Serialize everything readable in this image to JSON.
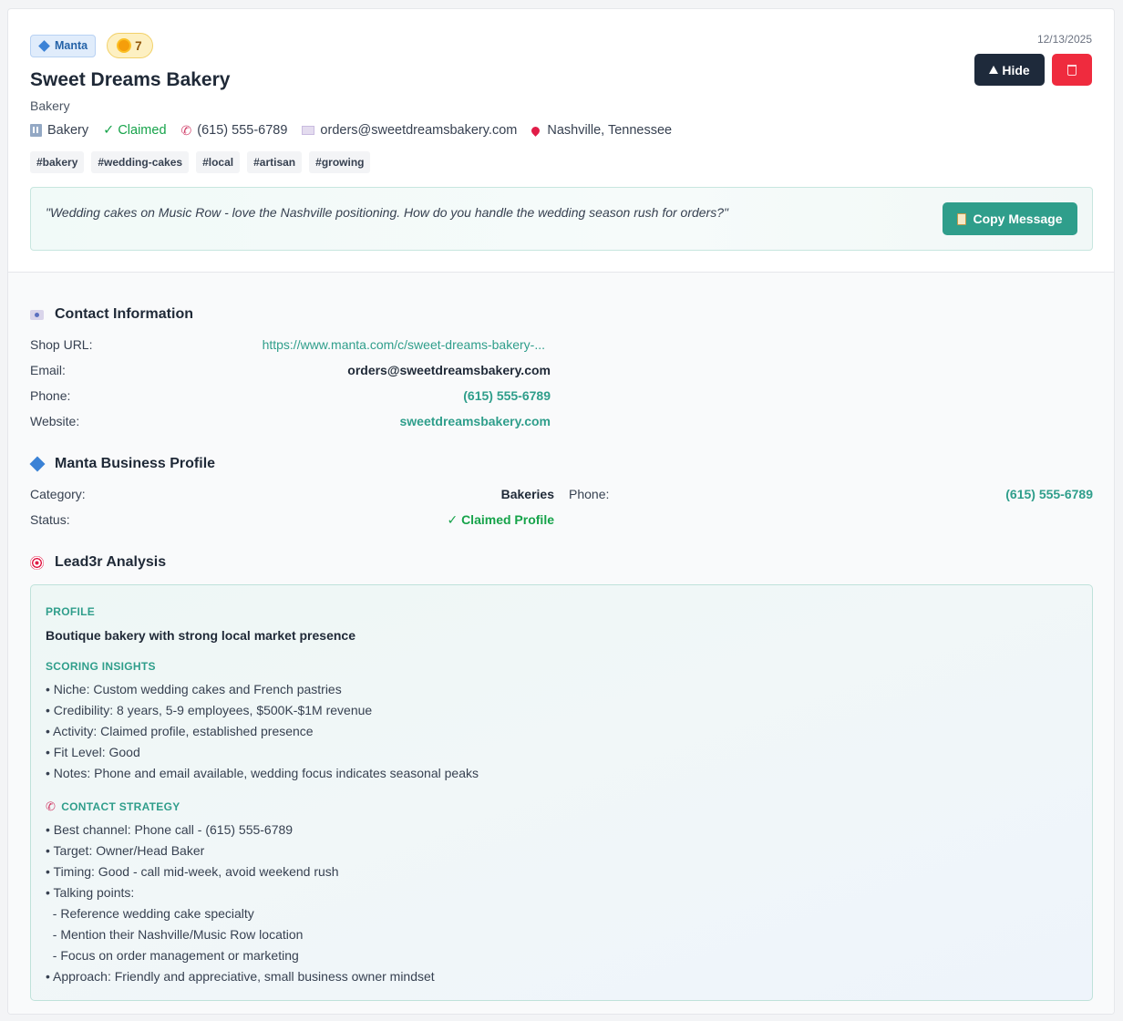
{
  "header": {
    "source_badge": "Manta",
    "score": "7",
    "title": "Sweet Dreams Bakery",
    "subtitle": "Bakery",
    "date": "12/13/2025",
    "hide_label": "Hide"
  },
  "meta": {
    "category": "Bakery",
    "claimed": "✓ Claimed",
    "phone": "(615) 555-6789",
    "email": "orders@sweetdreamsbakery.com",
    "location": "Nashville, Tennessee"
  },
  "tags": [
    "#bakery",
    "#wedding-cakes",
    "#local",
    "#artisan",
    "#growing"
  ],
  "message": {
    "text": "\"Wedding cakes on Music Row - love the Nashville positioning. How do you handle the wedding season rush for orders?\"",
    "copy_label": "Copy Message"
  },
  "contact": {
    "heading": "Contact Information",
    "rows": [
      {
        "label": "Shop URL:",
        "value": "https://www.manta.com/c/sweet-dreams-bakery-..."
      },
      {
        "label": "Email:",
        "value": "orders@sweetdreamsbakery.com"
      },
      {
        "label": "Phone:",
        "value": "(615) 555-6789"
      },
      {
        "label": "Website:",
        "value": "sweetdreamsbakery.com"
      }
    ]
  },
  "manta": {
    "heading": "Manta Business Profile",
    "category_label": "Category:",
    "category_value": "Bakeries",
    "phone_label": "Phone:",
    "phone_value": "(615) 555-6789",
    "status_label": "Status:",
    "status_value": "✓ Claimed Profile"
  },
  "analysis": {
    "heading": "Lead3r Analysis",
    "profile_heading": "PROFILE",
    "profile_text": "Boutique bakery with strong local market presence",
    "insights_heading": "SCORING INSIGHTS",
    "insights": [
      "• Niche: Custom wedding cakes and French pastries",
      "• Credibility: 8 years, 5-9 employees, $500K-$1M revenue",
      "• Activity: Claimed profile, established presence",
      "• Fit Level: Good",
      "• Notes: Phone and email available, wedding focus indicates seasonal peaks"
    ],
    "strategy_heading": "CONTACT STRATEGY",
    "strategy": [
      "• Best channel: Phone call - (615) 555-6789",
      "• Target: Owner/Head Baker",
      "• Timing: Good - call mid-week, avoid weekend rush",
      "• Talking points:",
      "  - Reference wedding cake specialty",
      "  - Mention their Nashville/Music Row location",
      "  - Focus on order management or marketing",
      "• Approach: Friendly and appreciative, small business owner mindset"
    ]
  },
  "colors": {
    "accent": "#2f9e8b",
    "dark_button": "#1e2a3b",
    "danger": "#ef2b3e",
    "claimed": "#16a34a"
  }
}
